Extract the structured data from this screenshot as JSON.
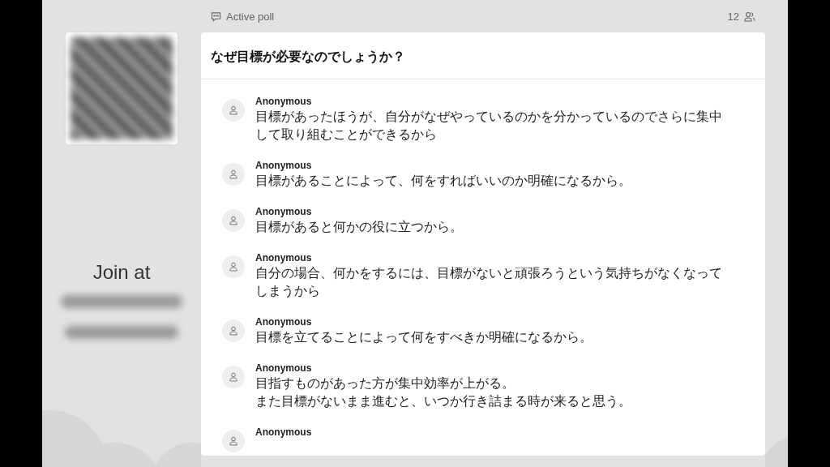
{
  "sidebar": {
    "join_label": "Join at"
  },
  "header": {
    "label": "Active poll",
    "participants": "12"
  },
  "poll": {
    "question": "なぜ目標が必要なのでしょうか？",
    "responses": [
      {
        "author": "Anonymous",
        "paragraphs": [
          "目標があったほうが、自分がなぜやっているのかを分かっているのでさらに集中して取り組むことができるから"
        ]
      },
      {
        "author": "Anonymous",
        "paragraphs": [
          "目標があることによって、何をすればいいのか明確になるから。"
        ]
      },
      {
        "author": "Anonymous",
        "paragraphs": [
          "目標があると何かの役に立つから。"
        ]
      },
      {
        "author": "Anonymous",
        "paragraphs": [
          "自分の場合、何かをするには、目標がないと頑張ろうという気持ちがなくなってしまうから"
        ]
      },
      {
        "author": "Anonymous",
        "paragraphs": [
          "目標を立てることによって何をすべきか明確になるから。"
        ]
      },
      {
        "author": "Anonymous",
        "paragraphs": [
          "目指すものがあった方が集中効率が上がる。",
          "また目標がないまま進むと、いつか行き詰まる時が来ると思う。"
        ]
      },
      {
        "author": "Anonymous"
      }
    ]
  }
}
